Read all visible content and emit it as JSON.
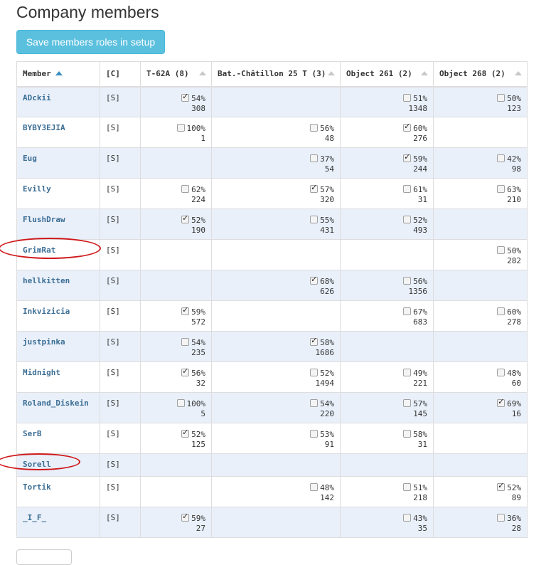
{
  "page": {
    "title": "Company members",
    "save_button_label": "Save members roles in setup"
  },
  "table": {
    "columns": [
      {
        "label": "Member",
        "sortable": true,
        "sorted": "asc"
      },
      {
        "label": "[C]",
        "sortable": false
      },
      {
        "label": "T-62A (8)",
        "sortable": true
      },
      {
        "label": "Bat.-Châtillon 25 T (3)",
        "sortable": true
      },
      {
        "label": "Object 261 (2)",
        "sortable": true
      },
      {
        "label": "Object 268 (2)",
        "sortable": true
      }
    ],
    "rows": [
      {
        "name": "ADckii",
        "role": "[S]",
        "height": "tall",
        "tanks": [
          {
            "checked": true,
            "pct": "54%",
            "battles": "308"
          },
          null,
          {
            "checked": false,
            "pct": "51%",
            "battles": "1348"
          },
          {
            "checked": false,
            "pct": "50%",
            "battles": "123"
          }
        ]
      },
      {
        "name": "BYBY3EJIA",
        "role": "[S]",
        "height": "tall",
        "tanks": [
          {
            "checked": false,
            "pct": "100%",
            "battles": "1"
          },
          {
            "checked": false,
            "pct": "56%",
            "battles": "48"
          },
          {
            "checked": true,
            "pct": "60%",
            "battles": "276"
          },
          null
        ]
      },
      {
        "name": "Eug",
        "role": "[S]",
        "height": "tall",
        "tanks": [
          null,
          {
            "checked": false,
            "pct": "37%",
            "battles": "54"
          },
          {
            "checked": true,
            "pct": "59%",
            "battles": "244"
          },
          {
            "checked": false,
            "pct": "42%",
            "battles": "98"
          }
        ]
      },
      {
        "name": "Evilly",
        "role": "[S]",
        "height": "tall",
        "tanks": [
          {
            "checked": false,
            "pct": "62%",
            "battles": "224"
          },
          {
            "checked": true,
            "pct": "57%",
            "battles": "320"
          },
          {
            "checked": false,
            "pct": "61%",
            "battles": "31"
          },
          {
            "checked": false,
            "pct": "63%",
            "battles": "210"
          }
        ]
      },
      {
        "name": "FlushDraw",
        "role": "[S]",
        "height": "tall",
        "tanks": [
          {
            "checked": true,
            "pct": "52%",
            "battles": "190"
          },
          {
            "checked": false,
            "pct": "55%",
            "battles": "431"
          },
          {
            "checked": false,
            "pct": "52%",
            "battles": "493"
          },
          null
        ]
      },
      {
        "name": "GrimRat",
        "role": "[S]",
        "height": "tall",
        "tanks": [
          null,
          null,
          null,
          {
            "checked": false,
            "pct": "50%",
            "battles": "282"
          }
        ]
      },
      {
        "name": "hellkitten",
        "role": "[S]",
        "height": "tall",
        "tanks": [
          null,
          {
            "checked": true,
            "pct": "68%",
            "battles": "626"
          },
          {
            "checked": false,
            "pct": "56%",
            "battles": "1356"
          },
          null
        ]
      },
      {
        "name": "Inkvizicia",
        "role": "[S]",
        "height": "tall",
        "tanks": [
          {
            "checked": true,
            "pct": "59%",
            "battles": "572"
          },
          null,
          {
            "checked": false,
            "pct": "67%",
            "battles": "683"
          },
          {
            "checked": false,
            "pct": "60%",
            "battles": "278"
          }
        ]
      },
      {
        "name": "justpinka",
        "role": "[S]",
        "height": "tall",
        "tanks": [
          {
            "checked": false,
            "pct": "54%",
            "battles": "235"
          },
          {
            "checked": true,
            "pct": "58%",
            "battles": "1686"
          },
          null,
          null
        ]
      },
      {
        "name": "Midnight",
        "role": "[S]",
        "height": "tall",
        "tanks": [
          {
            "checked": true,
            "pct": "56%",
            "battles": "32"
          },
          {
            "checked": false,
            "pct": "52%",
            "battles": "1494"
          },
          {
            "checked": false,
            "pct": "49%",
            "battles": "221"
          },
          {
            "checked": false,
            "pct": "48%",
            "battles": "60"
          }
        ]
      },
      {
        "name": "Roland_Diskein",
        "role": "[S]",
        "height": "tall",
        "tanks": [
          {
            "checked": false,
            "pct": "100%",
            "battles": "5"
          },
          {
            "checked": false,
            "pct": "54%",
            "battles": "220"
          },
          {
            "checked": false,
            "pct": "57%",
            "battles": "145"
          },
          {
            "checked": true,
            "pct": "69%",
            "battles": "16"
          }
        ]
      },
      {
        "name": "SerB",
        "role": "[S]",
        "height": "tall",
        "tanks": [
          {
            "checked": true,
            "pct": "52%",
            "battles": "125"
          },
          {
            "checked": false,
            "pct": "53%",
            "battles": "91"
          },
          {
            "checked": false,
            "pct": "58%",
            "battles": "31"
          },
          null
        ]
      },
      {
        "name": "Sorell",
        "role": "[S]",
        "height": "short",
        "tanks": [
          null,
          null,
          null,
          null
        ]
      },
      {
        "name": "Tortik",
        "role": "[S]",
        "height": "tall",
        "tanks": [
          null,
          {
            "checked": false,
            "pct": "48%",
            "battles": "142"
          },
          {
            "checked": false,
            "pct": "51%",
            "battles": "218"
          },
          {
            "checked": true,
            "pct": "52%",
            "battles": "89"
          }
        ]
      },
      {
        "name": "_I_F_",
        "role": "[S]",
        "height": "tall",
        "tanks": [
          {
            "checked": true,
            "pct": "59%",
            "battles": "27"
          },
          null,
          {
            "checked": false,
            "pct": "43%",
            "battles": "35"
          },
          {
            "checked": false,
            "pct": "36%",
            "battles": "28"
          }
        ]
      }
    ]
  },
  "colors": {
    "button_bg": "#5bc0de",
    "link": "#3c6e95",
    "row_stripe": "#e9f0fa",
    "annotation": "#d0191b"
  }
}
